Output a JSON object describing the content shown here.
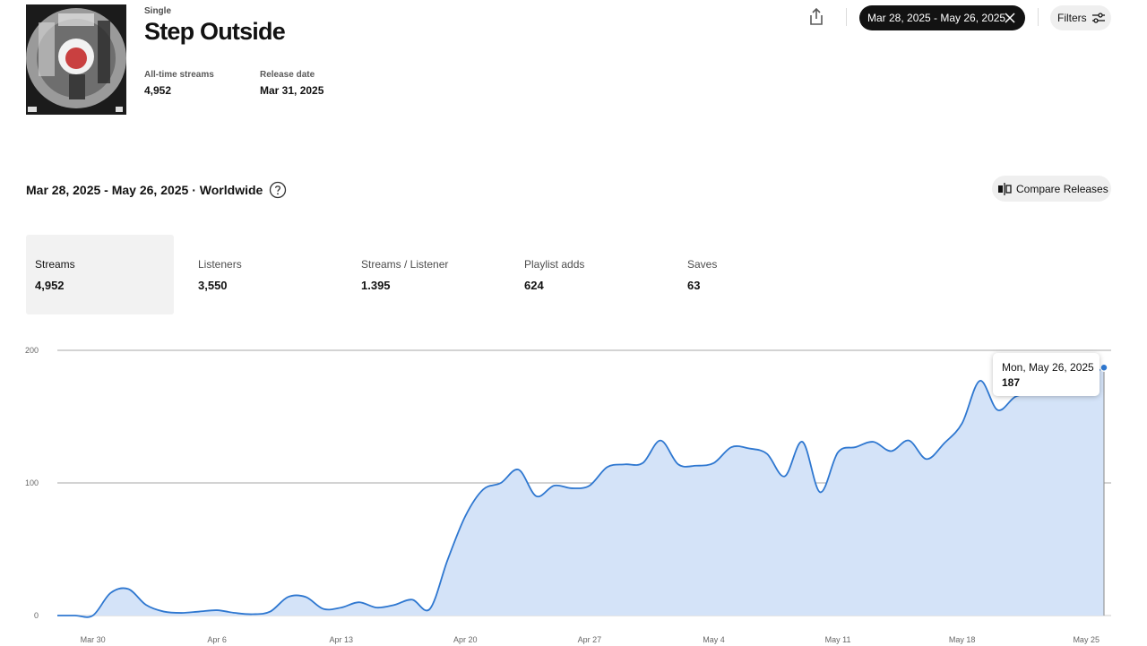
{
  "release": {
    "type": "Single",
    "title": "Step Outside",
    "all_time_label": "All-time streams",
    "all_time_value": "4,952",
    "release_date_label": "Release date",
    "release_date_value": "Mar 31, 2025"
  },
  "toolbar": {
    "date_range": "Mar 28, 2025 - May 26, 2025",
    "filters_label": "Filters"
  },
  "section": {
    "title": "Mar 28, 2025 - May 26, 2025 · Worldwide",
    "compare_label": "Compare Releases"
  },
  "metrics": [
    {
      "label": "Streams",
      "value": "4,952"
    },
    {
      "label": "Listeners",
      "value": "3,550"
    },
    {
      "label": "Streams / Listener",
      "value": "1.395"
    },
    {
      "label": "Playlist adds",
      "value": "624"
    },
    {
      "label": "Saves",
      "value": "63"
    }
  ],
  "tooltip": {
    "date": "Mon, May 26, 2025",
    "value": "187"
  },
  "colors": {
    "line": "#2e77d0",
    "fill": "#d4e3f8",
    "active_bg": "#f2f2f2"
  },
  "chart_data": {
    "type": "area",
    "ylim": [
      0,
      200
    ],
    "y_ticks": [
      "0",
      "100",
      "200"
    ],
    "x_tick_labels": [
      "Mar 30",
      "Apr 6",
      "Apr 13",
      "Apr 20",
      "Apr 27",
      "May 4",
      "May 11",
      "May 18",
      "May 25"
    ],
    "x_tick_index": [
      2,
      9,
      16,
      23,
      30,
      37,
      44,
      51,
      58
    ],
    "highlight_index": 59,
    "values": [
      0,
      0,
      0,
      17,
      20,
      8,
      3,
      2,
      3,
      4,
      2,
      1,
      3,
      14,
      14,
      5,
      6,
      10,
      6,
      8,
      12,
      5,
      42,
      75,
      95,
      100,
      110,
      90,
      98,
      96,
      98,
      112,
      114,
      115,
      132,
      114,
      113,
      115,
      127,
      126,
      122,
      105,
      131,
      93,
      123,
      127,
      131,
      124,
      132,
      118,
      130,
      145,
      177,
      155,
      165,
      168,
      172,
      175,
      180,
      187
    ]
  }
}
